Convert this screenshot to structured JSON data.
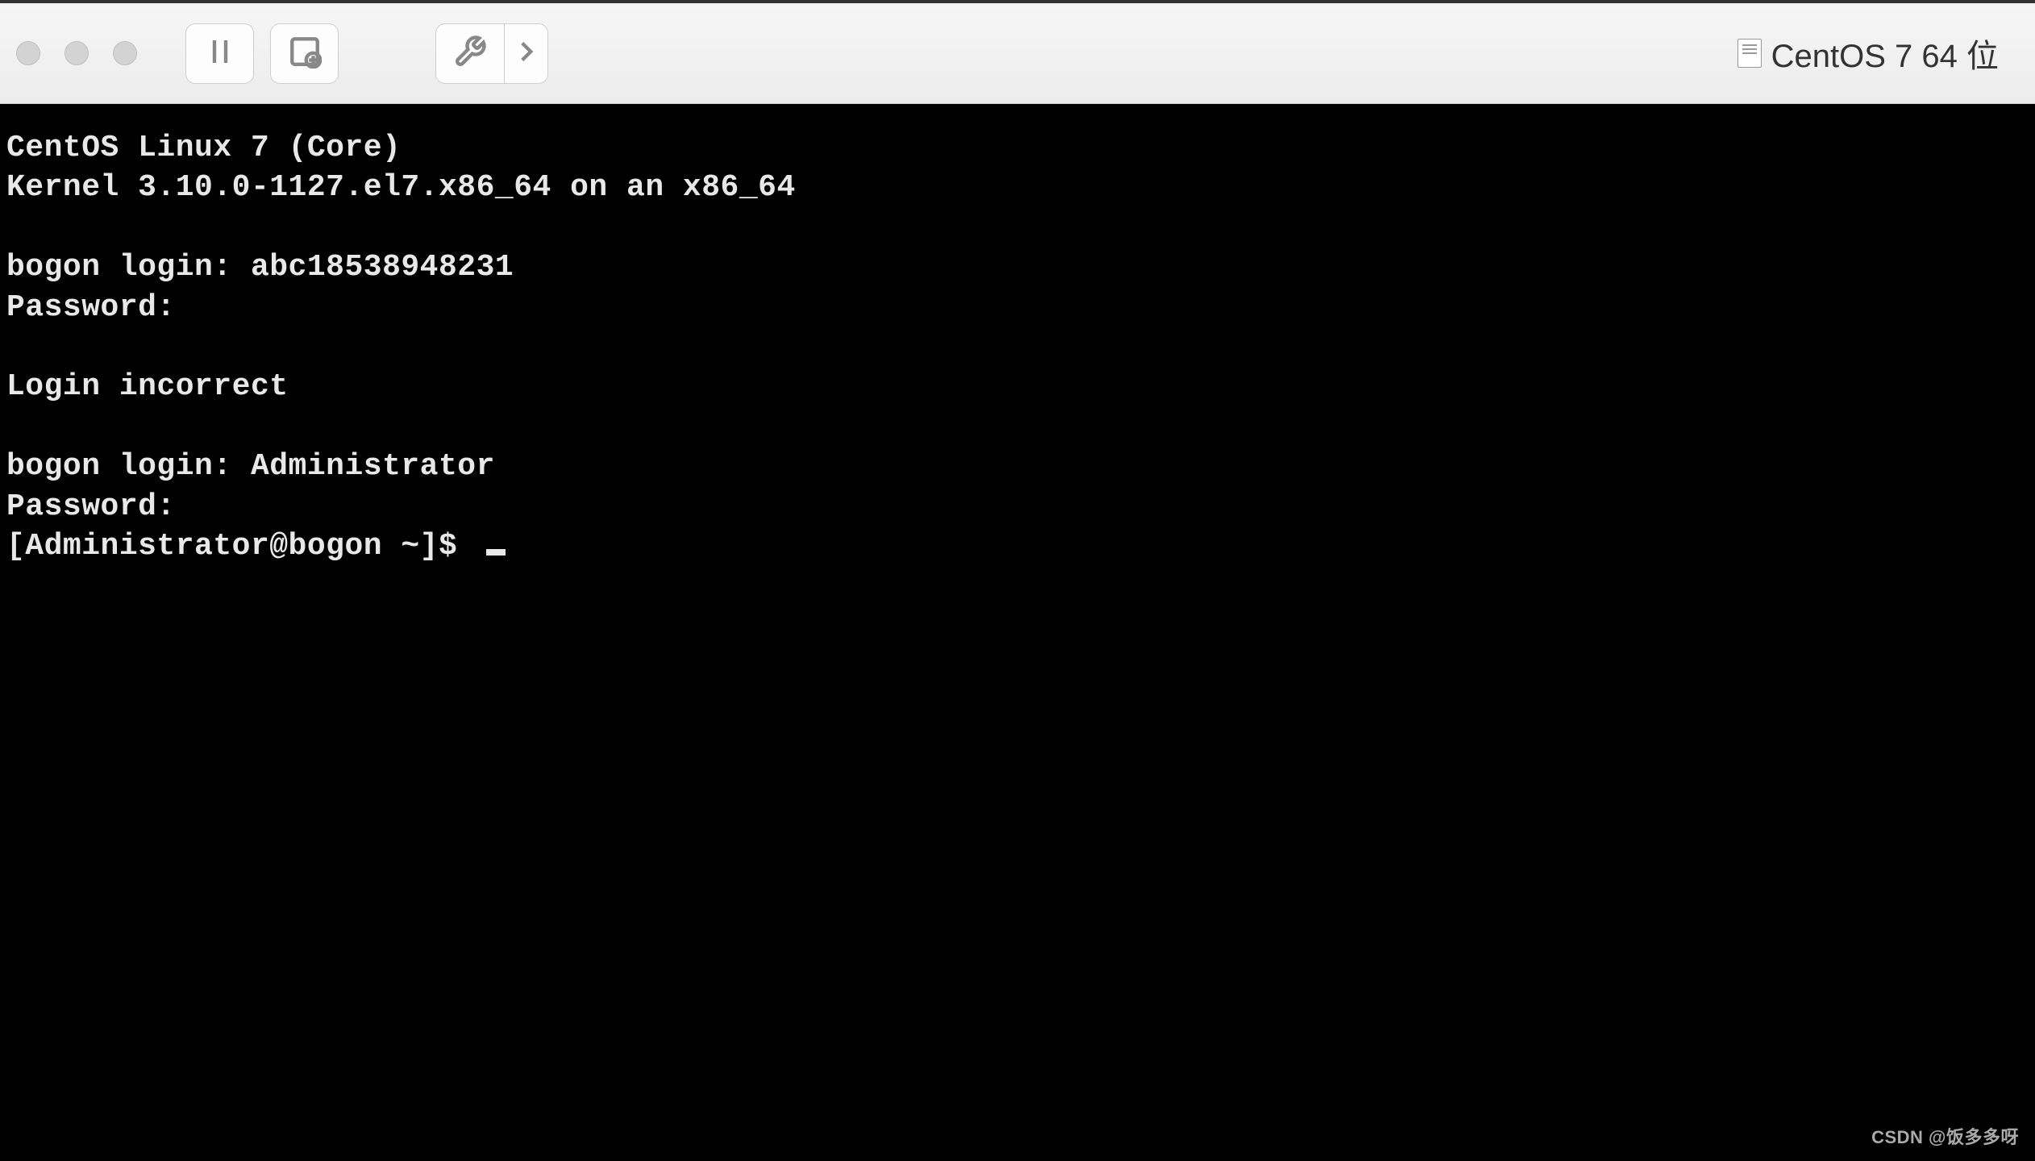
{
  "toolbar": {
    "title": "CentOS 7 64 位"
  },
  "terminal": {
    "line1": "CentOS Linux 7 (Core)",
    "line2": "Kernel 3.10.0-1127.el7.x86_64 on an x86_64",
    "blank1": "",
    "line3": "bogon login: abc18538948231",
    "line4": "Password:",
    "blank2": "",
    "line5": "Login incorrect",
    "blank3": "",
    "line6": "bogon login: Administrator",
    "line7": "Password:",
    "prompt": "[Administrator@bogon ~]$ "
  },
  "watermark": "CSDN @饭多多呀"
}
